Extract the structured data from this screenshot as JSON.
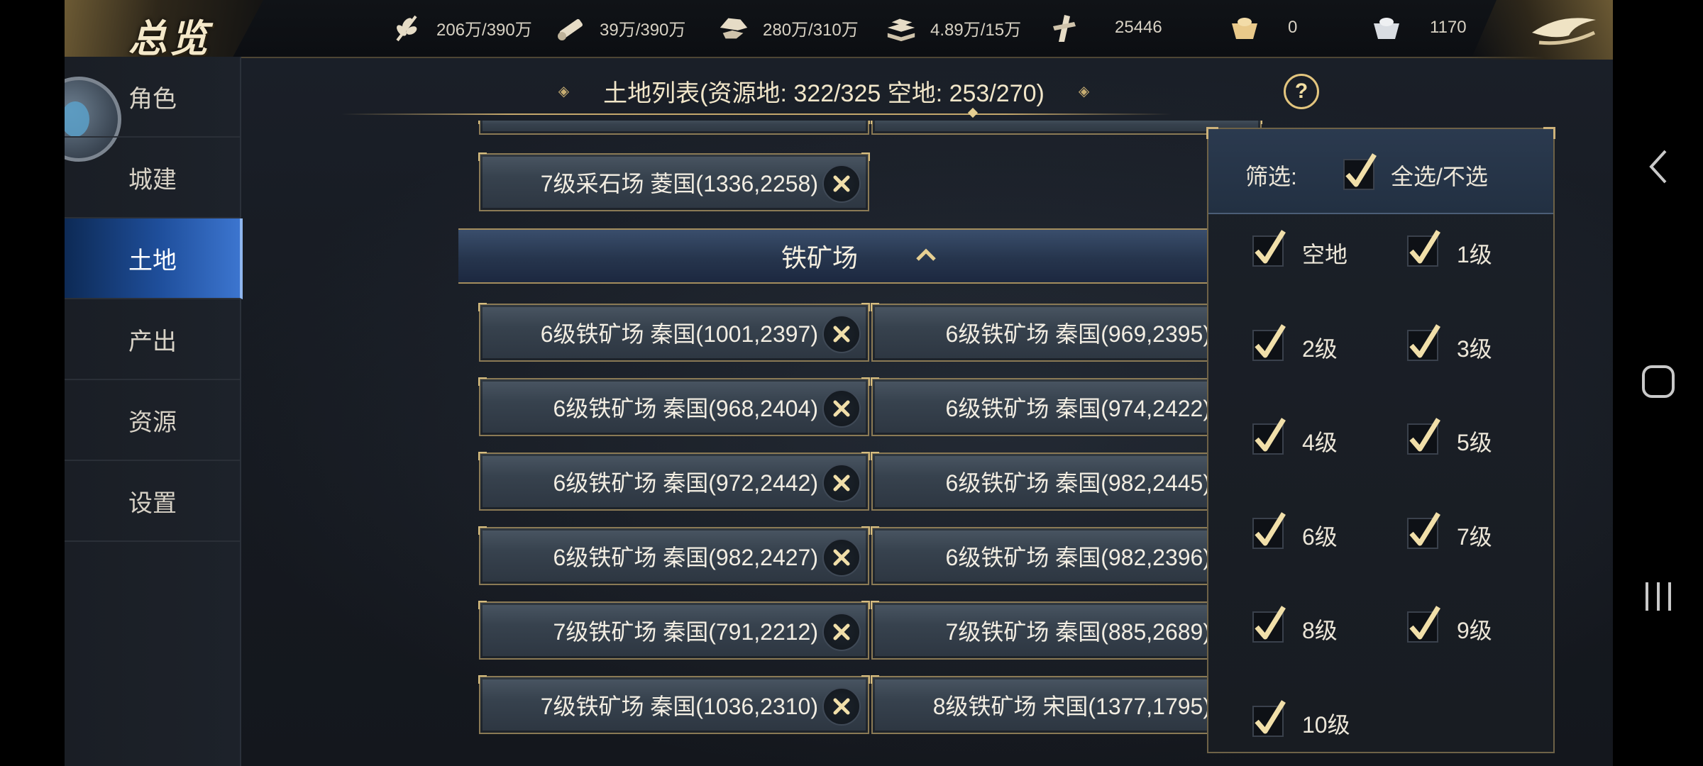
{
  "app": {
    "title": "总览"
  },
  "resources": [
    {
      "icon": "grain-icon",
      "value": "206万/390万"
    },
    {
      "icon": "wood-icon",
      "value": "39万/390万"
    },
    {
      "icon": "stone-icon",
      "value": "280万/310万"
    },
    {
      "icon": "iron-icon",
      "value": "4.89万/15万"
    },
    {
      "icon": "decree-icon",
      "value": "25446"
    },
    {
      "icon": "gold-ingot-icon",
      "value": "0"
    },
    {
      "icon": "silver-ingot-icon",
      "value": "1170"
    }
  ],
  "sidebar": {
    "items": [
      {
        "label": "角色"
      },
      {
        "label": "城建"
      },
      {
        "label": "土地",
        "active": true
      },
      {
        "label": "产出"
      },
      {
        "label": "资源"
      },
      {
        "label": "设置"
      }
    ]
  },
  "list_header": {
    "title": "土地列表(资源地: 322/325   空地: 253/270)",
    "help": "?"
  },
  "land_list": {
    "stone_item": "7级采石场 菱国(1336,2258)",
    "section_title": "铁矿场",
    "iron_items": [
      "6级铁矿场 秦国(1001,2397)",
      "6级铁矿场 秦国(969,2395)",
      "6级铁矿场 秦国(968,2404)",
      "6级铁矿场 秦国(974,2422)",
      "6级铁矿场 秦国(972,2442)",
      "6级铁矿场 秦国(982,2445)",
      "6级铁矿场 秦国(982,2427)",
      "6级铁矿场 秦国(982,2396)",
      "7级铁矿场 秦国(791,2212)",
      "7级铁矿场 秦国(885,2689)",
      "7级铁矿场 秦国(1036,2310)",
      "8级铁矿场 宋国(1377,1795)"
    ]
  },
  "filter": {
    "label": "筛选:",
    "select_all": "全选/不选",
    "select_all_checked": true,
    "options": [
      {
        "label": "空地",
        "checked": true
      },
      {
        "label": "1级",
        "checked": true
      },
      {
        "label": "2级",
        "checked": true
      },
      {
        "label": "3级",
        "checked": true
      },
      {
        "label": "4级",
        "checked": true
      },
      {
        "label": "5级",
        "checked": true
      },
      {
        "label": "6级",
        "checked": true
      },
      {
        "label": "7级",
        "checked": true
      },
      {
        "label": "8级",
        "checked": true
      },
      {
        "label": "9级",
        "checked": true
      },
      {
        "label": "10级",
        "checked": true
      }
    ]
  },
  "colors": {
    "accent_gold": "#c9ab6c",
    "active_tab": "#2f66bd",
    "check": "#f1dfa9"
  }
}
